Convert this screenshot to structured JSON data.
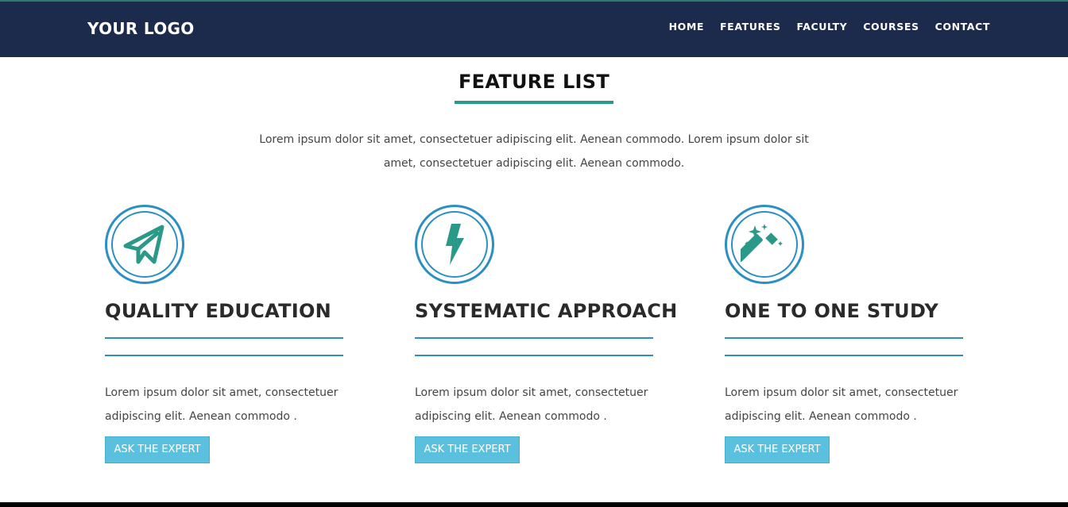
{
  "header": {
    "logo": "YOUR LOGO",
    "nav": [
      "HOME",
      "FEATURES",
      "FACULTY",
      "COURSES",
      "CONTACT"
    ]
  },
  "section": {
    "title": "FEATURE LIST",
    "intro": "Lorem ipsum dolor sit amet, consectetuer adipiscing elit. Aenean commodo. Lorem ipsum dolor sit amet, consectetuer adipiscing elit. Aenean commodo."
  },
  "features": [
    {
      "icon": "paper-plane-icon",
      "title": "QUALITY EDUCATION",
      "text": "Lorem ipsum dolor sit amet, consectetuer adipiscing elit. Aenean commodo .",
      "button": "ASK THE EXPERT"
    },
    {
      "icon": "lightning-bolt-icon",
      "title": "SYSTEMATIC APPROACH",
      "text": "Lorem ipsum dolor sit amet, consectetuer adipiscing elit. Aenean commodo .",
      "button": "ASK THE EXPERT"
    },
    {
      "icon": "magic-wand-icon",
      "title": "ONE TO ONE STUDY",
      "text": "Lorem ipsum dolor sit amet, consectetuer adipiscing elit. Aenean commodo .",
      "button": "ASK THE EXPERT"
    }
  ],
  "colors": {
    "navbar": "#1c2a4b",
    "accent_teal": "#2a9988",
    "accent_blue": "#2b8fc4",
    "button": "#5bc0de"
  }
}
